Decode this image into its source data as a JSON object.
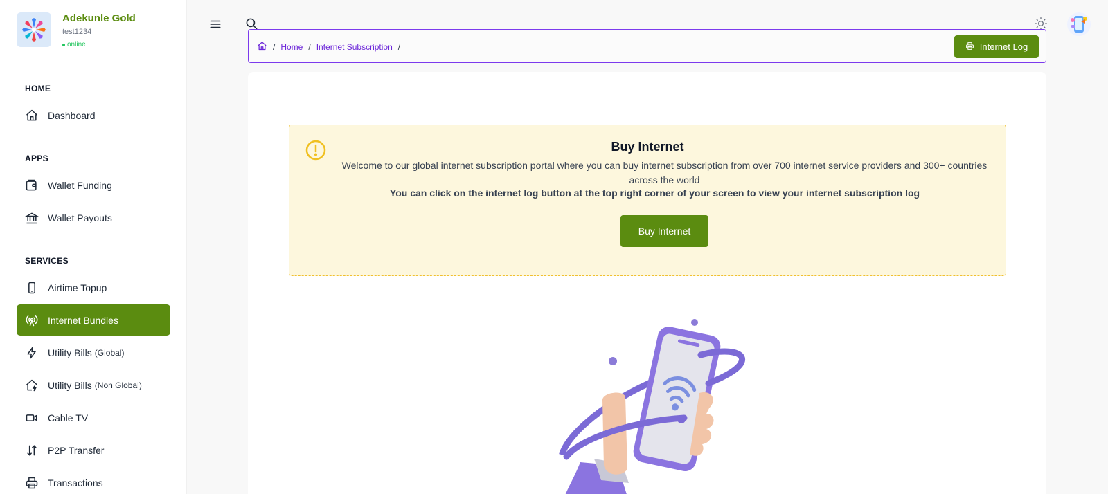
{
  "profile": {
    "name": "Adekunle Gold",
    "username": "test1234",
    "status": "online"
  },
  "sidebar": {
    "sections": {
      "home": "HOME",
      "apps": "APPS",
      "services": "SERVICES"
    },
    "items": [
      {
        "label": "Dashboard",
        "icon": "home-icon"
      },
      {
        "label": "Wallet Funding",
        "icon": "wallet-icon"
      },
      {
        "label": "Wallet Payouts",
        "icon": "bank-icon"
      },
      {
        "label": "Airtime Topup",
        "icon": "phone-icon"
      },
      {
        "label": "Internet Bundles",
        "icon": "broadcast-icon",
        "active": true
      },
      {
        "label": "Utility Bills",
        "suffix": "(Global)",
        "icon": "bolt-icon"
      },
      {
        "label": "Utility Bills",
        "suffix": "(Non Global)",
        "icon": "home-bolt-icon"
      },
      {
        "label": "Cable TV",
        "icon": "video-icon"
      },
      {
        "label": "P2P Transfer",
        "icon": "transfer-icon"
      },
      {
        "label": "Transactions",
        "icon": "printer-icon"
      }
    ]
  },
  "breadcrumb": {
    "home": "Home",
    "current": "Internet Subscription",
    "separator": "/"
  },
  "toolbar": {
    "log_button": "Internet Log"
  },
  "alert": {
    "title": "Buy Internet",
    "text": "Welcome to our global internet subscription portal where you can buy internet subscription from over 700 internet service providers and 300+ countries across the world",
    "bold_text": "You can click on the internet log button at the top right corner of your screen to view your internet subscription log",
    "button": "Buy Internet"
  },
  "colors": {
    "accent": "#5b8c10",
    "purple": "#7c3aed",
    "alert_bg": "#fdf7dd"
  }
}
